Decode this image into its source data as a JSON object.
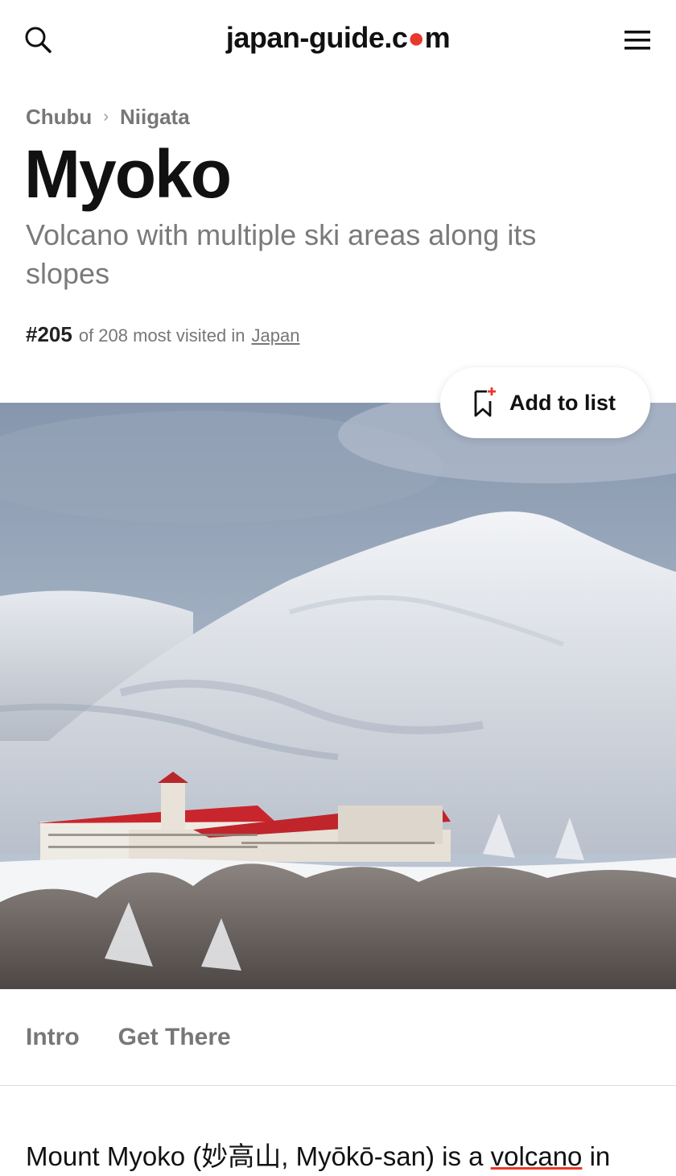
{
  "header": {
    "logo_prefix": "japan-guide.c",
    "logo_o": "o",
    "logo_suffix": "m",
    "search_icon": "search-icon",
    "menu_icon": "hamburger-menu-icon"
  },
  "breadcrumb": {
    "items": [
      "Chubu",
      "Niigata"
    ],
    "separator": "›"
  },
  "page": {
    "title": "Myoko",
    "subtitle": "Volcano with multiple ski areas along its slopes"
  },
  "rank": {
    "number": "#205",
    "text": "of 208 most visited in",
    "link": "Japan"
  },
  "add_to_list": {
    "label": "Add to list",
    "icon": "bookmark-plus-icon"
  },
  "tabs": [
    "Intro",
    "Get There"
  ],
  "intro": {
    "text_before": "Mount Myoko (妙高山, Myōkō-san) is a ",
    "link": "volcano",
    "text_after": " in"
  },
  "colors": {
    "accent": "#e8392c",
    "text": "#111111",
    "muted": "#777777"
  }
}
